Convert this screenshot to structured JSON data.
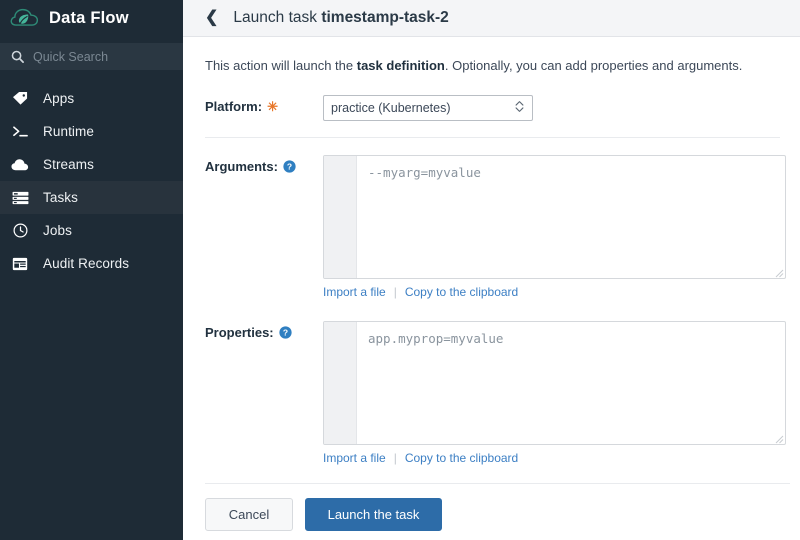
{
  "sidebar": {
    "brand": "Data Flow",
    "logo_icon": "spring-leaf-cloud-logo",
    "search": {
      "icon": "search-icon",
      "placeholder": "Quick Search",
      "value": ""
    },
    "items": [
      {
        "label": "Apps",
        "icon": "tag-icon",
        "active": false
      },
      {
        "label": "Runtime",
        "icon": "terminal-icon",
        "active": false
      },
      {
        "label": "Streams",
        "icon": "cloud-icon",
        "active": false
      },
      {
        "label": "Tasks",
        "icon": "server-icon",
        "active": true
      },
      {
        "label": "Jobs",
        "icon": "clock-icon",
        "active": false
      },
      {
        "label": "Audit Records",
        "icon": "window-icon",
        "active": false
      }
    ]
  },
  "topbar": {
    "back_icon": "chevron-left-icon",
    "title_prefix": "Launch task ",
    "title_name": "timestamp-task-2"
  },
  "main": {
    "intro_before": "This action will launch the ",
    "intro_bold": "task definition",
    "intro_after": ". Optionally, you can add properties and arguments.",
    "platform": {
      "label": "Platform:",
      "required_marker": "✳",
      "selected": "practice (Kubernetes)",
      "options": [
        "practice (Kubernetes)"
      ],
      "arrow_up_icon": "chevron-up-icon",
      "arrow_down_icon": "chevron-down-icon"
    },
    "arguments": {
      "label": "Arguments:",
      "help_icon": "help-circle-icon",
      "value": "",
      "placeholder": "--myarg=myvalue",
      "import_link": "Import a file",
      "separator": "|",
      "copy_link": "Copy to the clipboard"
    },
    "properties": {
      "label": "Properties:",
      "help_icon": "help-circle-icon",
      "value": "",
      "placeholder": "app.myprop=myvalue",
      "import_link": "Import a file",
      "separator": "|",
      "copy_link": "Copy to the clipboard"
    },
    "cancel_label": "Cancel",
    "launch_label": "Launch the task"
  },
  "colors": {
    "sidebar_bg": "#1e2b36",
    "sidebar_active": "#28333d",
    "accent_blue": "#2d6ca8",
    "link_blue": "#3c7fc4",
    "required_orange": "#e8772a",
    "logo_green": "#45b59a"
  }
}
